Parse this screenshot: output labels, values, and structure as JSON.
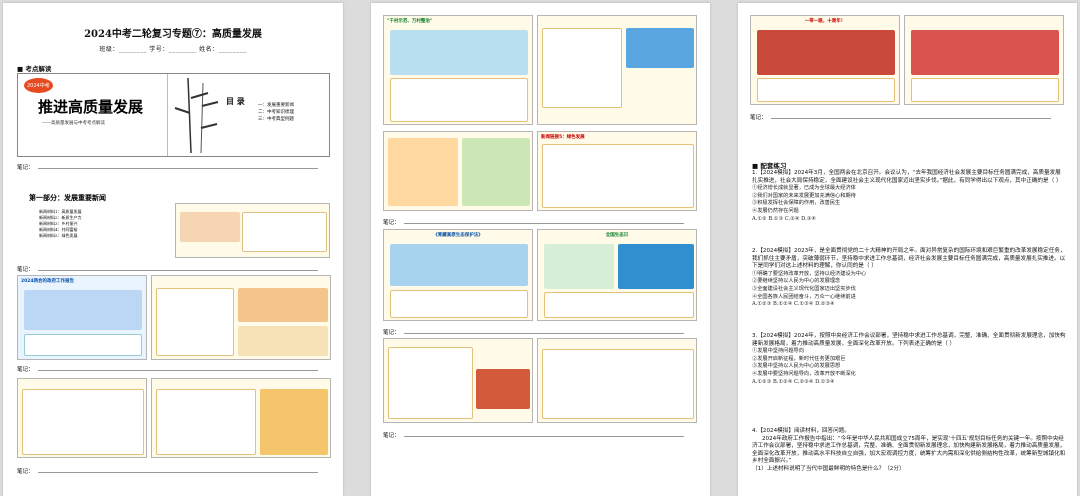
{
  "page1": {
    "title": "2024中考二轮复习专题⑦：高质量发展",
    "fields": "班级：________  学号：________  姓名：________",
    "section_point": "考点解读",
    "cover": {
      "badge": "2024中考",
      "heading": "推进高质量发展",
      "subheading": "——高质量发展与中考考点解读",
      "toc_title": "目 录",
      "toc_items": [
        "一：发展重要新闻",
        "二：中考知识梳理",
        "三：中考典型例题"
      ]
    },
    "note_label": "笔记：",
    "part_heading": "第一部分：发展重要新闻",
    "part_items": [
      "新闻材料1：高质量发展",
      "新闻材料2：新质生产力",
      "新闻材料3：乡村振兴",
      "新闻材料4：共同富裕",
      "新闻材料5：绿色发展"
    ],
    "slide_gov_report": "2024两会的政府工作报告"
  },
  "page2": {
    "slide_village": "\"千村示范、万村整治\"",
    "slide_green": "新闻链接5：绿色发展",
    "slide_eco": "《青藏高原生态保护法》",
    "slide_ecoday": "全国生态日",
    "note_label": "笔记："
  },
  "page3": {
    "slide_belt": "一带一路，十周年！",
    "section_practice": "配套练习",
    "questions": [
      "1.【2024模拟】2024年3月，全国两会在北京召开。会议认为，“去年我国经济社会发展主要目标任务圆满完成，高质量发展扎实推进，社会大局保持稳定，全面建设社会主义现代化国家迈出坚实步伐。”据此，有同学得出以下观点，其中正确的是（  ）",
      "2.【2024模拟】2023年，是全面贯彻党的二十大精神的开局之年。面对异常复杂的国际环境和艰巨繁重的改革发展稳定任务，我们抓住主要矛盾，突破薄弱环节，坚持稳中求进工作总基调，经济社会发展主要目标任务圆满完成，高质量发展扎实推进。以下是同学们对这上述材料的理解，你认同的是（  ）",
      "3.【2024模拟】2024年，按照中央经济工作会议部署，坚持稳中求进工作总基调，完整、准确、全面贯彻新发展理念，加快构建新发展格局，着力推动高质量发展，全面深化改革开放。下列表述正确的是（  ）",
      "4.【2024模拟】阅读材料，回答问题。",
      "2024年政府工作报告中指出：“今年是中华人民共和国成立75周年，是实现‘十四五’规划目标任务的关键一年。按照中央经济工作会议部署，坚持稳中求进工作总基调，完整、准确、全面贯彻新发展理念，加快构建新发展格局，着力推动高质量发展，全面深化改革开放，推动高水平科技自立自强，加大宏观调控力度，统筹扩大内需和深化供给侧结构性改革，统筹新型城镇化和乡村全面振兴。”",
      "（1）上述材料说明了当代中国最鲜明的特色是什么？（2分）"
    ],
    "q1_options": [
      "①经济增长成就显著，已成为全球最大经济体",
      "②我们对国家的未来发展更加充满信心和期待",
      "③积极发挥社会保障的作用，改善民生",
      "④发展仍然存在问题",
      "A.①②  B.①③  C.②④  D.③④"
    ],
    "q2_options": [
      "①明确了要坚持改革开放，坚持以经济建设为中心",
      "②要继续坚持以人民为中心的发展理念",
      "③全面建设社会主义现代化国家迈出坚实步伐",
      "④全国各族人民团结奋斗，万众一心继续前进",
      "A.①②③  B.①②④  C.①③④  D.②③④"
    ],
    "q3_options": [
      "①发展中坚持问题导向",
      "②发展开启新征程，新时代任务更加艰巨",
      "③发展中坚持以人民为中心的发展思想",
      "④发展中要坚持问题导向，改革开放不断深化",
      "A.①②③  B.①②④  C.②③④  D.①③④"
    ]
  }
}
